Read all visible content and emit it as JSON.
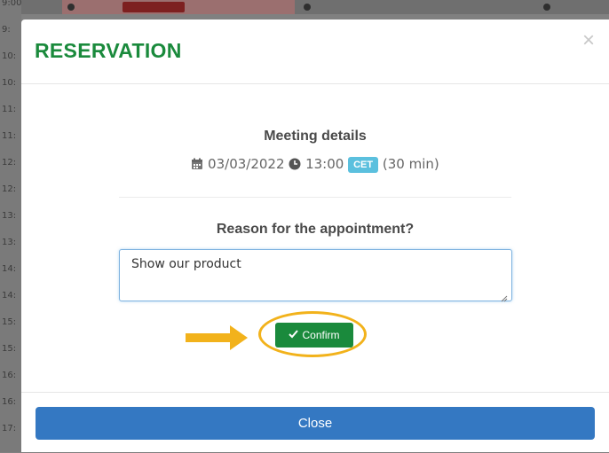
{
  "background": {
    "time_labels": [
      "9:00",
      "9:",
      "10:",
      "10:",
      "11:",
      "11:",
      "12:",
      "12:",
      "13:",
      "13:",
      "14:",
      "14:",
      "15:",
      "15:",
      "16:",
      "16:",
      "17:"
    ]
  },
  "modal": {
    "title": "RESERVATION",
    "close_icon": "×",
    "meeting_details": {
      "heading": "Meeting details",
      "date": "03/03/2022",
      "time": "13:00",
      "timezone": "CET",
      "duration": "(30 min)"
    },
    "reason": {
      "question": "Reason for the appointment?",
      "value": "Show our product"
    },
    "confirm_label": "Confirm",
    "close_label": "Close"
  },
  "colors": {
    "title_green": "#1a8a3c",
    "confirm_green": "#1a8a3c",
    "close_blue": "#3478c2",
    "badge_blue": "#5bc0de",
    "highlight_yellow": "#f2b21b"
  },
  "icons": [
    "calendar-icon",
    "clock-icon",
    "check-icon",
    "close-icon",
    "arrow-right-icon"
  ]
}
